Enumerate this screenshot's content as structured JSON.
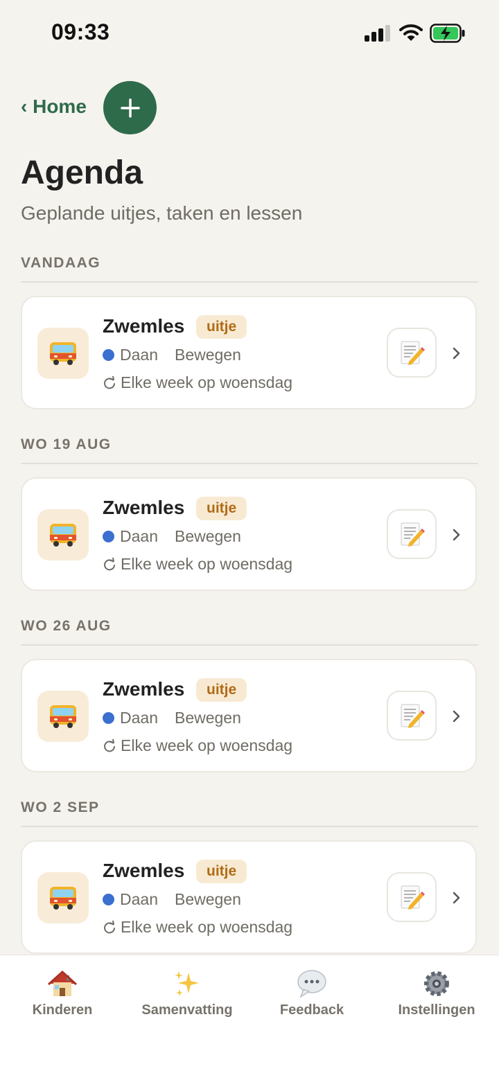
{
  "status_bar": {
    "time": "09:33"
  },
  "header": {
    "back_label": "‹ Home",
    "add_label": "+",
    "title": "Agenda",
    "subtitle": "Geplande uitjes, taken en lessen"
  },
  "sections": [
    {
      "header": "VANDAAG",
      "card": {
        "title": "Zwemles",
        "badge": "uitje",
        "child": "Daan",
        "category": "Bewegen",
        "recurrence": "Elke week op woensdag",
        "icon": "bus-icon"
      }
    },
    {
      "header": "WO 19 AUG",
      "card": {
        "title": "Zwemles",
        "badge": "uitje",
        "child": "Daan",
        "category": "Bewegen",
        "recurrence": "Elke week op woensdag",
        "icon": "bus-icon"
      }
    },
    {
      "header": "WO 26 AUG",
      "card": {
        "title": "Zwemles",
        "badge": "uitje",
        "child": "Daan",
        "category": "Bewegen",
        "recurrence": "Elke week op woensdag",
        "icon": "bus-icon"
      }
    },
    {
      "header": "WO 2 SEP",
      "card": {
        "title": "Zwemles",
        "badge": "uitje",
        "child": "Daan",
        "category": "Bewegen",
        "recurrence": "Elke week op woensdag",
        "icon": "bus-icon"
      }
    }
  ],
  "tab_bar": {
    "tabs": [
      {
        "label": "Kinderen",
        "icon": "house-icon"
      },
      {
        "label": "Samenvatting",
        "icon": "sparkles-icon"
      },
      {
        "label": "Feedback",
        "icon": "speech-bubble-icon"
      },
      {
        "label": "Instellingen",
        "icon": "gear-icon"
      }
    ]
  },
  "colors": {
    "accent": "#2e6b4b",
    "background": "#f5f3ee",
    "badge_bg": "#f8ead2",
    "badge_text": "#b06b17",
    "child_dot": "#3b6fd0"
  }
}
